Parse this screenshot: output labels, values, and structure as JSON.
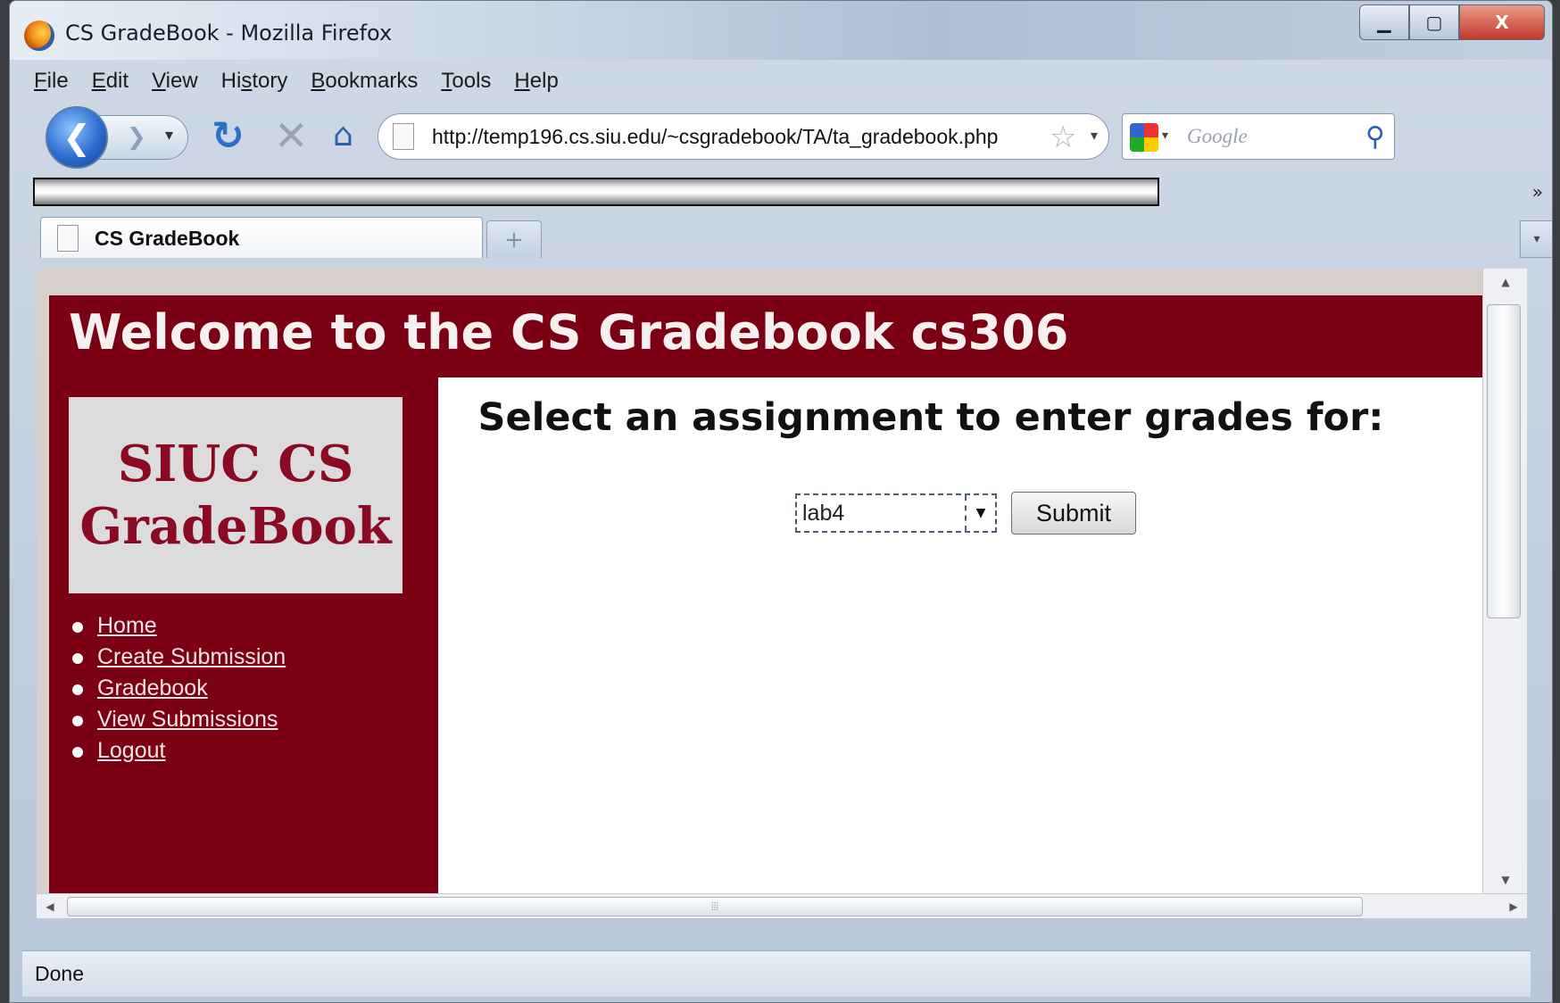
{
  "window": {
    "title": "CS GradeBook - Mozilla Firefox",
    "min_glyph": "▁",
    "max_glyph": "▢",
    "close_glyph": "X"
  },
  "menubar": {
    "items": [
      {
        "accel": "F",
        "rest": "ile"
      },
      {
        "accel": "E",
        "rest": "dit"
      },
      {
        "accel": "V",
        "rest": "iew"
      },
      {
        "pre": "Hi",
        "accel": "s",
        "rest": "tory"
      },
      {
        "accel": "B",
        "rest": "ookmarks"
      },
      {
        "accel": "T",
        "rest": "ools"
      },
      {
        "accel": "H",
        "rest": "elp"
      }
    ]
  },
  "navbar": {
    "back_glyph": "❮",
    "forward_glyph": "❯",
    "dropdown_glyph": "▾",
    "reload_glyph": "↻",
    "stop_glyph": "✕",
    "home_glyph": "⌂",
    "url": "http://temp196.cs.siu.edu/~csgradebook/TA/ta_gradebook.php",
    "star_glyph": "☆",
    "search_engine_icon": "google-icon",
    "search_placeholder": "Google",
    "search_glyph": "⚲"
  },
  "bookmarks": {
    "chevron": "»"
  },
  "tabs": {
    "active_label": "CS GradeBook",
    "new_tab_glyph": "+",
    "list_glyph": "▾"
  },
  "page": {
    "header_title": "Welcome to the CS Gradebook cs306",
    "logo_line1": "SIUC CS",
    "logo_line2": "GradeBook",
    "nav": [
      "Home",
      "Create Submission",
      "Gradebook",
      "View Submissions",
      "Logout"
    ],
    "heading": "Select an assignment to enter grades for:",
    "select_value": "lab4",
    "select_arrow": "▼",
    "submit_label": "Submit"
  },
  "scrollbars": {
    "up": "▲",
    "down": "▼",
    "left": "◀",
    "right": "▶",
    "grip": "⦙⦙⦙"
  },
  "status": {
    "text": "Done"
  },
  "colors": {
    "brand_maroon": "#7b0014",
    "logo_text": "#8a0a24"
  }
}
